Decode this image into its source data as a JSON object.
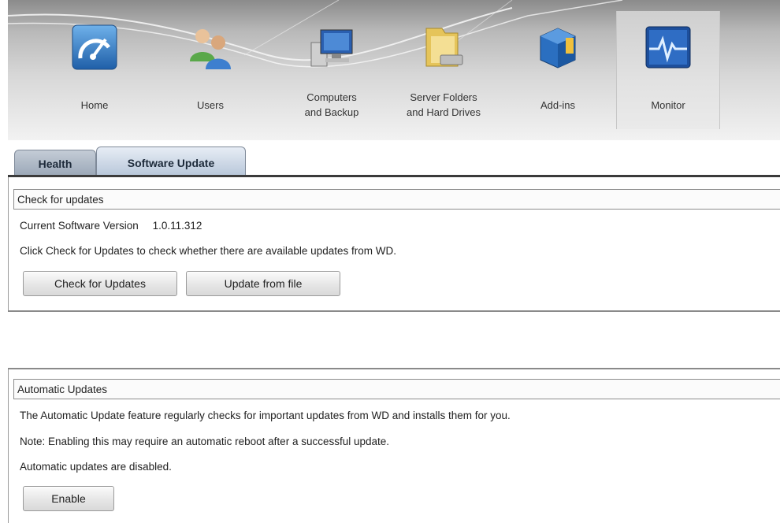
{
  "nav": {
    "items": [
      {
        "label": "Home",
        "icon": "speedometer-icon"
      },
      {
        "label": "Users",
        "icon": "users-icon"
      },
      {
        "label": "Computers\nand Backup",
        "icon": "computer-icon"
      },
      {
        "label": "Server Folders\nand Hard Drives",
        "icon": "folder-icon"
      },
      {
        "label": "Add-ins",
        "icon": "cube-icon"
      },
      {
        "label": "Monitor",
        "icon": "heartbeat-monitor-icon"
      }
    ],
    "active": "Monitor"
  },
  "tabs": {
    "health": "Health",
    "software_update": "Software Update",
    "active": "Software Update"
  },
  "check_updates": {
    "header": "Check for updates",
    "version_label": "Current Software Version",
    "version_value": "1.0.11.312",
    "description": "Click Check for Updates to check whether there are available updates from WD.",
    "check_button": "Check for Updates",
    "file_button": "Update from file"
  },
  "auto_updates": {
    "header": "Automatic Updates",
    "description": "The Automatic Update feature regularly checks for important updates from WD and installs them for you.",
    "note": "Note: Enabling this may require an automatic reboot after a successful update.",
    "status": "Automatic updates are disabled.",
    "enable_button": "Enable"
  },
  "colors": {
    "tab_active": "#b8c7da",
    "tab_inactive": "#9ba8b8",
    "panel_border": "#8c8c8c"
  }
}
